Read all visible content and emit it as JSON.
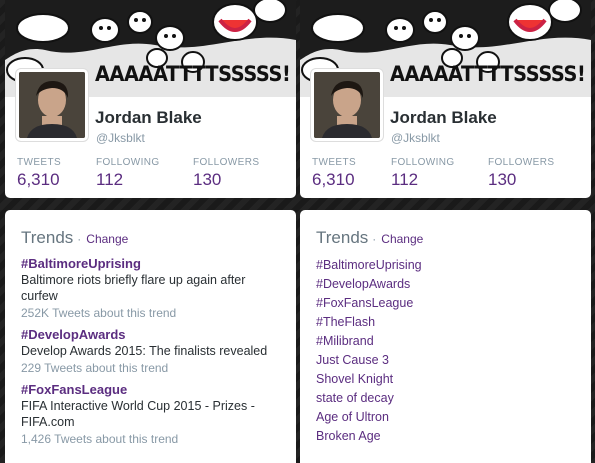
{
  "colors": {
    "accent": "#5b2d80",
    "muted": "#8899a6",
    "text": "#292f33"
  },
  "profile": {
    "banner_text": "AAAAATTTTSSSSS!",
    "name": "Jordan Blake",
    "handle": "@Jksblkt",
    "stats": [
      {
        "label": "TWEETS",
        "value": "6,310"
      },
      {
        "label": "FOLLOWING",
        "value": "112"
      },
      {
        "label": "FOLLOWERS",
        "value": "130"
      }
    ]
  },
  "trends_detailed": {
    "title": "Trends",
    "separator": "·",
    "change_label": "Change",
    "items": [
      {
        "name": "#BaltimoreUprising",
        "desc": "Baltimore riots briefly flare up again after curfew",
        "count": "252K Tweets about this trend"
      },
      {
        "name": "#DevelopAwards",
        "desc": "Develop Awards 2015: The finalists revealed",
        "count": "229 Tweets about this trend"
      },
      {
        "name": "#FoxFansLeague",
        "desc": "FIFA Interactive World Cup 2015 - Prizes - FIFA.com",
        "count": "1,426 Tweets about this trend"
      }
    ]
  },
  "trends_simple": {
    "title": "Trends",
    "separator": "·",
    "change_label": "Change",
    "items": [
      "#BaltimoreUprising",
      "#DevelopAwards",
      "#FoxFansLeague",
      "#TheFlash",
      "#Milibrand",
      "Just Cause 3",
      "Shovel Knight",
      "state of decay",
      "Age of Ultron",
      "Broken Age"
    ]
  }
}
